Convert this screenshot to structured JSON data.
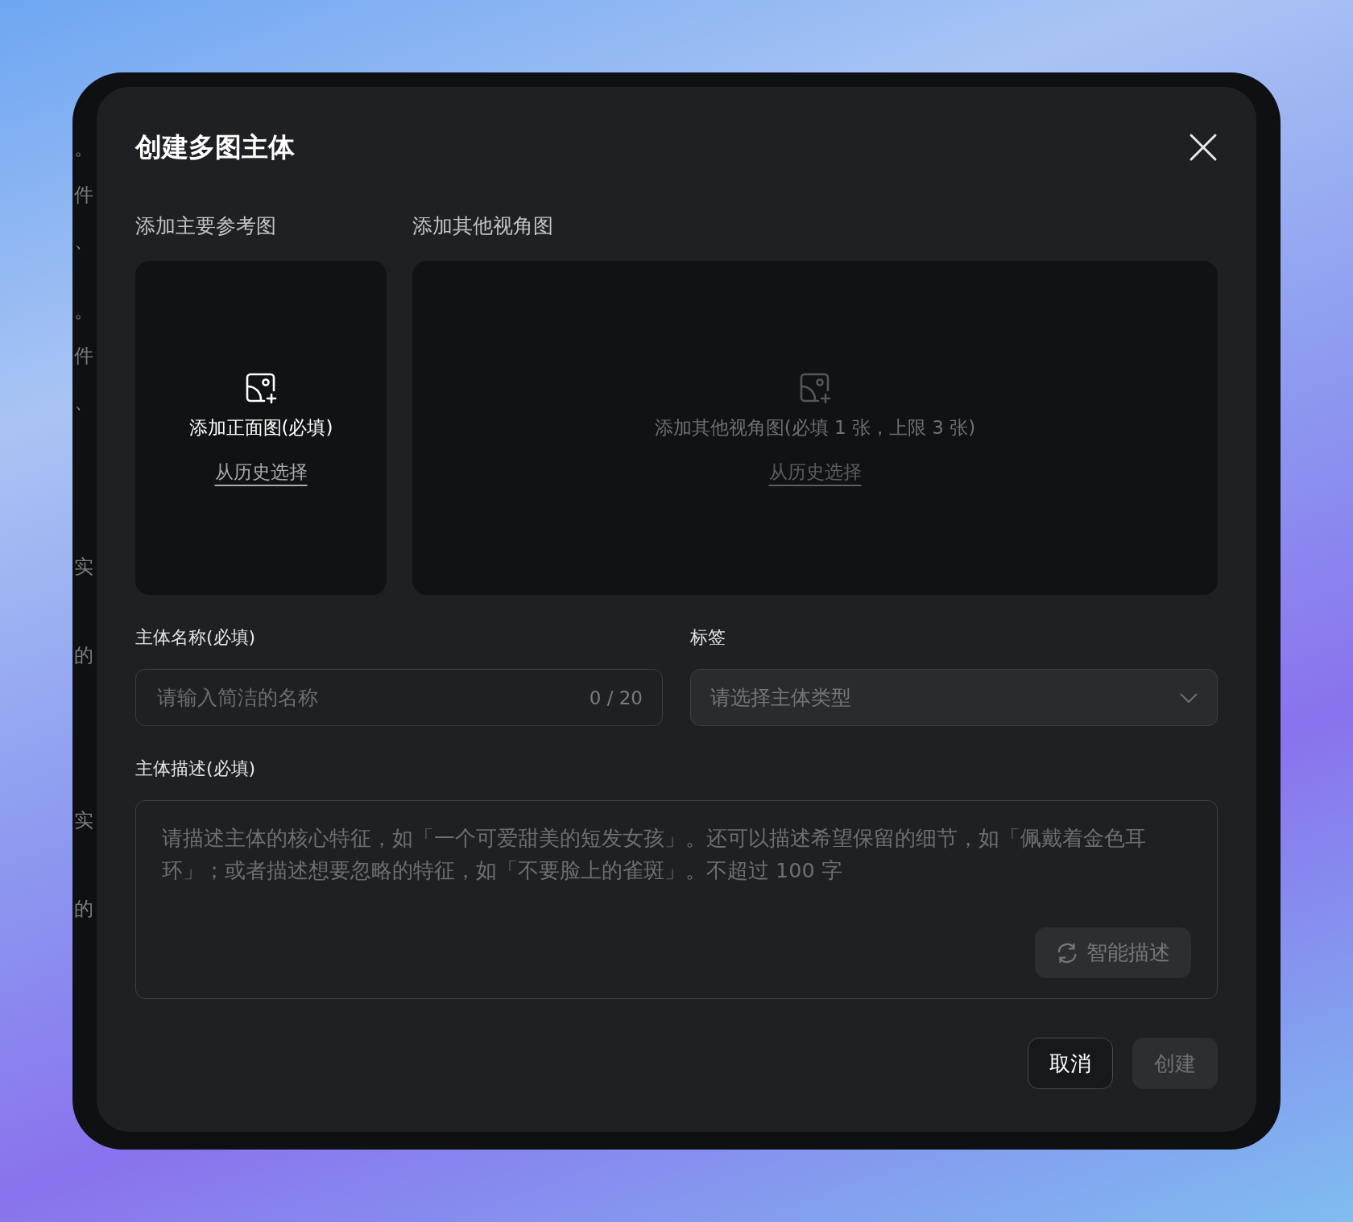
{
  "background_fragments": [
    "。",
    "件",
    "、",
    "。",
    "件",
    "、",
    "实",
    "的",
    "实",
    "的"
  ],
  "dialog": {
    "title": "创建多图主体",
    "upload_sections": [
      {
        "label": "添加主要参考图",
        "hint": "添加正面图(必填)",
        "link": "从历史选择",
        "disabled": false
      },
      {
        "label": "添加其他视角图",
        "hint": "添加其他视角图(必填 1 张，上限 3 张)",
        "link": "从历史选择",
        "disabled": true
      }
    ],
    "name_field": {
      "label": "主体名称(必填)",
      "placeholder": "请输入简洁的名称",
      "counter": "0 / 20"
    },
    "tag_field": {
      "label": "标签",
      "placeholder": "请选择主体类型"
    },
    "description_field": {
      "label": "主体描述(必填)",
      "placeholder": "请描述主体的核心特征，如「一个可爱甜美的短发女孩」。还可以描述希望保留的细节，如「佩戴着金色耳环」；或者描述想要忽略的特征，如「不要脸上的雀斑」。不超过 100 字",
      "assist_button": "智能描述"
    },
    "buttons": [
      {
        "label": "取消",
        "disabled": false
      },
      {
        "label": "创建",
        "disabled": true
      }
    ]
  }
}
